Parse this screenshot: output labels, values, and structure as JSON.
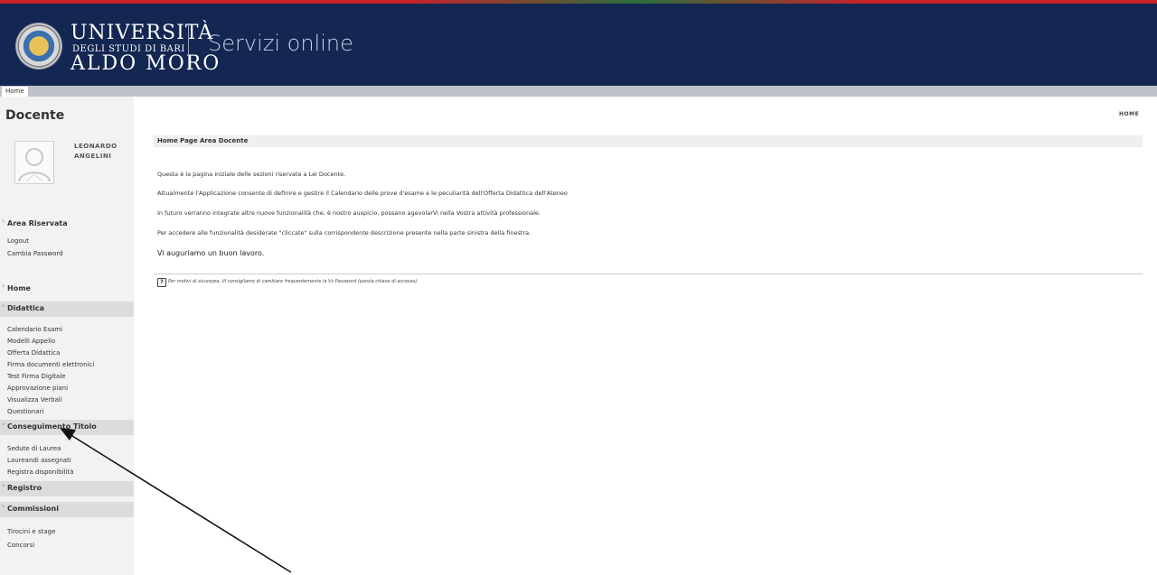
{
  "header": {
    "logo_line1": "UNIVERSITÀ",
    "logo_line2": "DEGLI STUDI DI BARI",
    "logo_line3": "ALDO MORO",
    "title": "Servizi online"
  },
  "breadcrumb": {
    "home": "Home"
  },
  "sidebar": {
    "title": "Docente",
    "user_first": "LEONARDO",
    "user_last": "ANGELINI",
    "area_riservata": {
      "label": "Area Riservata",
      "links": [
        "Logout",
        "Cambia Password"
      ]
    },
    "home_label": "Home",
    "didattica": {
      "label": "Didattica",
      "links": [
        "Calendario Esami",
        "Modelli Appello",
        "Offerta Didattica",
        "Firma documenti elettronici",
        "Test Firma Digitale",
        "Approvazione piani",
        "Visualizza Verbali",
        "Questionari"
      ]
    },
    "conseguimento": {
      "label": "Conseguimento Titolo",
      "links": [
        "Sedute di Laurea",
        "Laureandi assegnati",
        "Registra disponibilità"
      ]
    },
    "registro_label": "Registro",
    "commissioni": {
      "label": "Commissioni",
      "links": [
        "Tirocini e stage",
        "Concorsi"
      ]
    }
  },
  "main": {
    "home_right": "HOME",
    "page_title": "Home Page Area Docente",
    "paragraphs": [
      "Questa è la pagina iniziale delle sezioni riservate a Lei Docente.",
      "Attualmente l'Applicazione consente di definire e gestire il Calendario delle prove d'esame e le peculiarità dell'Offerta Didattica dell'Ateneo",
      "In futuro verranno integrate altre nuove funzionalità che, è nostro auspicio, possano agevolarVi nella Vostra attività professionale.",
      "Per accedere alle funzionalità desiderate \"cliccate\" sulla corrispondente descrizione presente nella parte sinistra della finestra."
    ],
    "wish": "Vi auguriamo un buon lavoro.",
    "note": "Per motivi di sicurezza, Vi consigliamo di cambiare frequentemente la Vs Password (parola chiave di accesso)."
  },
  "colors": {
    "header_bg": "#142652",
    "sidebar_bg": "#f2f2f2",
    "section_bg": "#dcdcdc"
  }
}
